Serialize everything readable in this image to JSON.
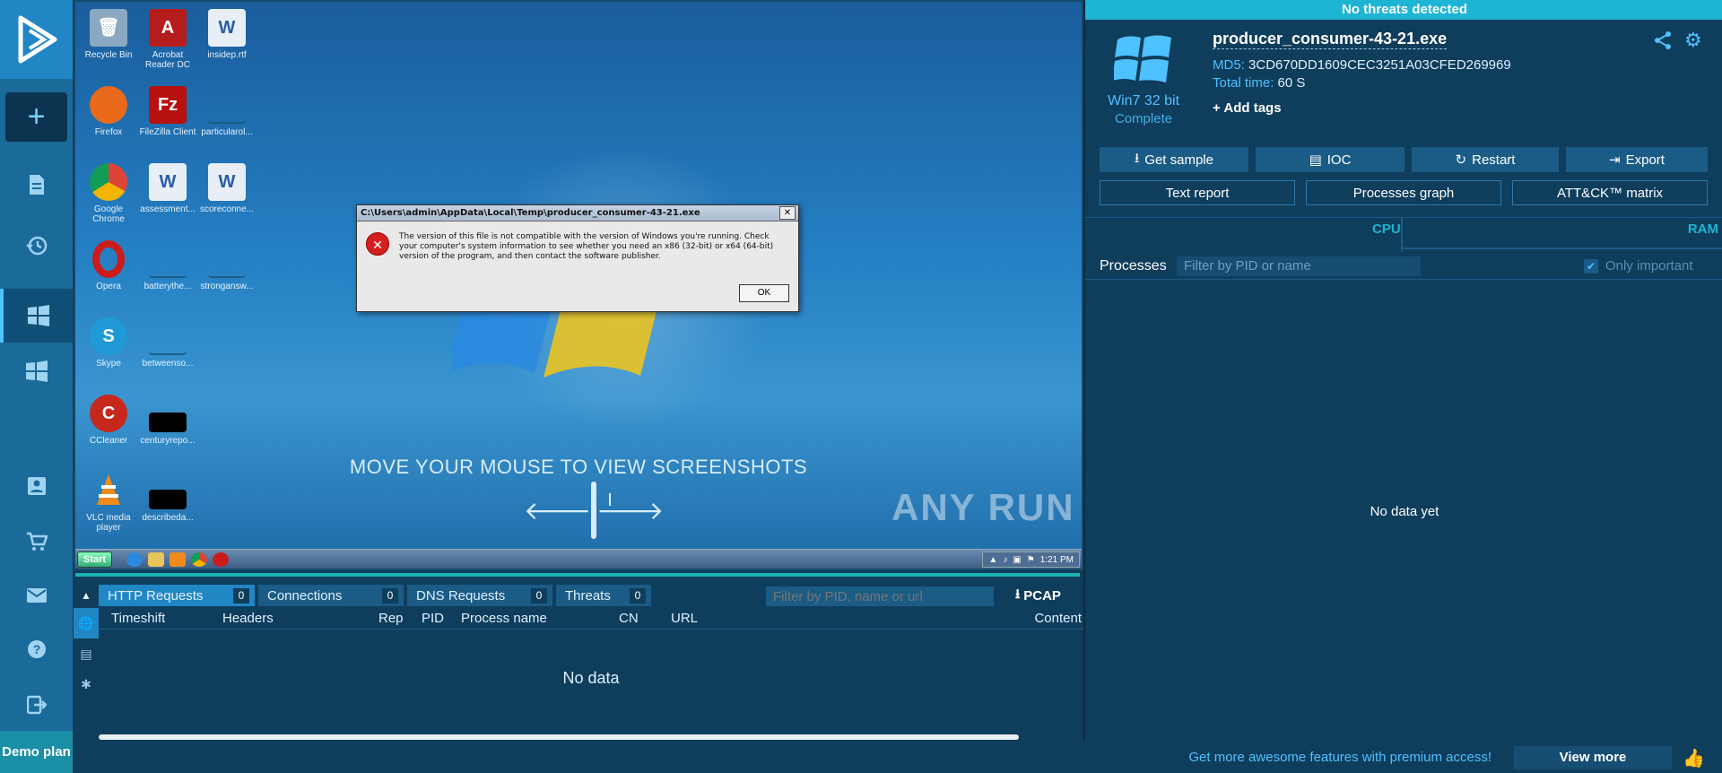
{
  "sidebar": {
    "items": [
      {
        "icon": "plus-icon"
      },
      {
        "icon": "document-icon"
      },
      {
        "icon": "history-icon"
      },
      {
        "icon": "windows-icon"
      },
      {
        "icon": "windows-icon"
      },
      {
        "icon": "contact-icon"
      },
      {
        "icon": "cart-icon"
      },
      {
        "icon": "mail-icon"
      },
      {
        "icon": "help-icon"
      },
      {
        "icon": "logout-icon"
      }
    ],
    "plan_label": "Demo plan"
  },
  "desktop": {
    "icons": [
      {
        "label": "Recycle Bin"
      },
      {
        "label": "Acrobat Reader DC"
      },
      {
        "label": "insidep.rtf"
      },
      {
        "label": "Firefox"
      },
      {
        "label": "FileZilla Client"
      },
      {
        "label": "particularol..."
      },
      {
        "label": "Google Chrome"
      },
      {
        "label": "assessment..."
      },
      {
        "label": "scoreconne..."
      },
      {
        "label": "Opera"
      },
      {
        "label": "batterythe..."
      },
      {
        "label": "strongansw..."
      },
      {
        "label": "Skype"
      },
      {
        "label": "betweenso..."
      },
      {
        "label": "CCleaner"
      },
      {
        "label": "centuryrepo..."
      },
      {
        "label": "VLC media player"
      },
      {
        "label": "describeda..."
      }
    ],
    "overlay_text": "MOVE YOUR MOUSE TO VIEW SCREENSHOTS",
    "watermark": "ANY RUN",
    "taskbar": {
      "start_label": "Start",
      "clock": "1:21 PM"
    },
    "dialog": {
      "title": "C:\\Users\\admin\\AppData\\Local\\Temp\\producer_consumer-43-21.exe",
      "message": "The version of this file is not compatible with the version of Windows you're running. Check your computer's system information to see whether you need an x86 (32-bit) or x64 (64-bit) version of the program, and then contact the software publisher.",
      "ok_label": "OK"
    }
  },
  "network": {
    "tabs": [
      {
        "label": "HTTP Requests",
        "count": "0"
      },
      {
        "label": "Connections",
        "count": "0"
      },
      {
        "label": "DNS Requests",
        "count": "0"
      },
      {
        "label": "Threats",
        "count": "0"
      }
    ],
    "filter_placeholder": "Filter by PID, name or url",
    "pcap_label": "PCAP",
    "columns": [
      "Timeshift",
      "Headers",
      "Rep",
      "PID",
      "Process name",
      "CN",
      "URL",
      "Content"
    ],
    "empty_text": "No data"
  },
  "footer": {
    "promo": "Get more awesome features with premium access!",
    "view_more": "View more"
  },
  "report": {
    "verdict": "No threats detected",
    "os_name": "Win7 32 bit",
    "os_status": "Complete",
    "filename": "producer_consumer-43-21.exe",
    "md5_label": "MD5:",
    "md5_value": "3CD670DD1609CEC3251A03CFED269969",
    "time_label": "Total time:",
    "time_value": "60 S",
    "add_tags": "Add tags",
    "actions": [
      {
        "label": "Get sample",
        "icon": "download-icon"
      },
      {
        "label": "IOC",
        "icon": "ioc-icon"
      },
      {
        "label": "Restart",
        "icon": "restart-icon"
      },
      {
        "label": "Export",
        "icon": "export-icon"
      }
    ],
    "views": [
      "Text report",
      "Processes graph",
      "ATT&CK™ matrix"
    ],
    "cpu_label": "CPU",
    "ram_label": "RAM",
    "processes_title": "Processes",
    "processes_filter_placeholder": "Filter by PID or name",
    "only_important": "Only important",
    "only_important_checked": true,
    "empty_text": "No data yet"
  },
  "colors": {
    "accent": "#2186c4",
    "verdict_bg": "#1eb4d4",
    "panel_bg": "#0f3d5c",
    "link": "#4ec1ff"
  }
}
